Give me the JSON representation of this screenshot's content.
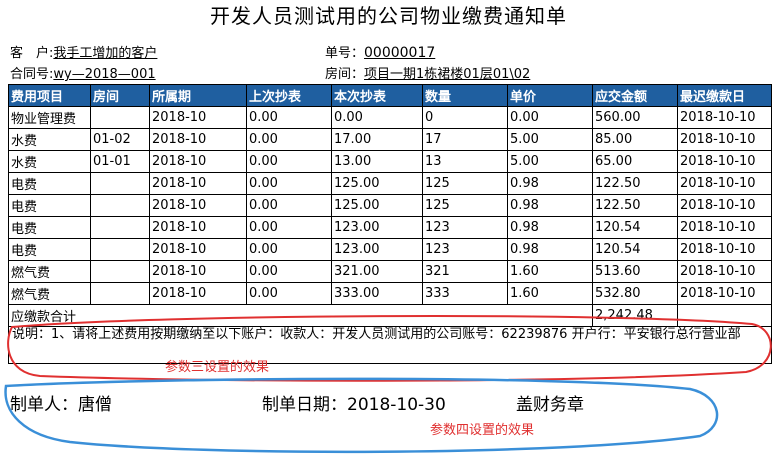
{
  "title": "开发人员测试用的公司物业缴费通知单",
  "header": {
    "customer_label": "客　户:",
    "customer_value": "我手工增加的客户",
    "bill_no_label": "单号：",
    "bill_no_value": "00000017",
    "contract_label": "合同号:",
    "contract_value": "wy—2018—001",
    "room_label": "房间：",
    "room_value": "项目一期1栋裙楼01层01\\02"
  },
  "table": {
    "columns": [
      "费用项目",
      "房间",
      "所属期",
      "上次抄表",
      "本次抄表",
      "数量",
      "单价",
      "应交金额",
      "最迟缴款日"
    ],
    "rows": [
      [
        "物业管理费",
        "",
        "2018-10",
        "0.00",
        "0.00",
        "0",
        "0.00",
        "560.00",
        "2018-10-10"
      ],
      [
        "水费",
        "01-02",
        "2018-10",
        "0.00",
        "17.00",
        "17",
        "5.00",
        "85.00",
        "2018-10-10"
      ],
      [
        "水费",
        "01-01",
        "2018-10",
        "0.00",
        "13.00",
        "13",
        "5.00",
        "65.00",
        "2018-10-10"
      ],
      [
        "电费",
        "",
        "2018-10",
        "0.00",
        "125.00",
        "125",
        "0.98",
        "122.50",
        "2018-10-10"
      ],
      [
        "电费",
        "",
        "2018-10",
        "0.00",
        "125.00",
        "125",
        "0.98",
        "122.50",
        "2018-10-10"
      ],
      [
        "电费",
        "",
        "2018-10",
        "0.00",
        "123.00",
        "123",
        "0.98",
        "120.54",
        "2018-10-10"
      ],
      [
        "电费",
        "",
        "2018-10",
        "0.00",
        "123.00",
        "123",
        "0.98",
        "120.54",
        "2018-10-10"
      ],
      [
        "燃气费",
        "",
        "2018-10",
        "0.00",
        "321.00",
        "321",
        "1.60",
        "513.60",
        "2018-10-10"
      ],
      [
        "燃气费",
        "",
        "2018-10",
        "0.00",
        "333.00",
        "333",
        "1.60",
        "532.80",
        "2018-10-10"
      ]
    ],
    "total_label": "应缴款合计",
    "total_value": "2,242.48"
  },
  "note": "说明：1、请将上述费用按期缴纳至以下账户：收款人：开发人员测试用的公司账号：62239876 开户行：平安银行总行营业部",
  "footer": {
    "maker": "制单人：唐僧",
    "date": "制单日期：2018-10-30",
    "seal": "盖财务章"
  },
  "annotations": {
    "param3": "参数三设置的效果",
    "param4": "参数四设置的效果"
  },
  "colors": {
    "header_bg": "#1f5fa0",
    "red_mark": "#e03030",
    "blue_mark": "#3a8fd8"
  }
}
